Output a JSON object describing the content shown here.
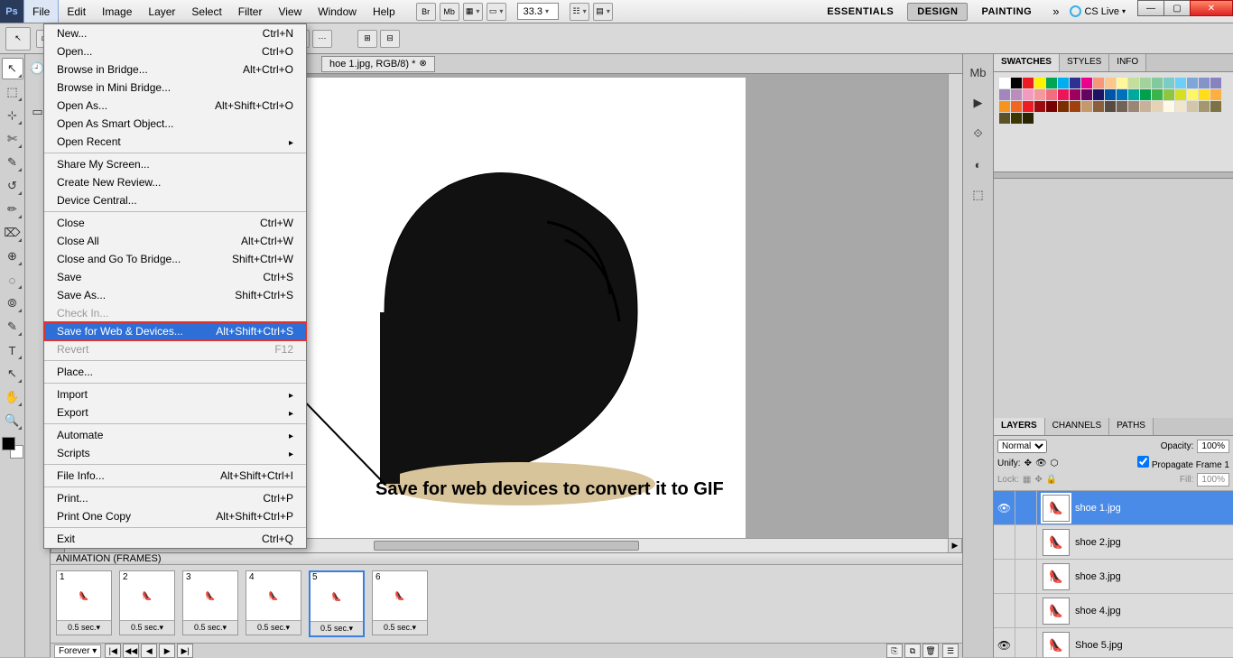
{
  "menubar": {
    "items": [
      "File",
      "Edit",
      "Image",
      "Layer",
      "Select",
      "Filter",
      "View",
      "Window",
      "Help"
    ],
    "active": 0,
    "br_btn": "Br",
    "mb_btn": "Mb",
    "zoom": "33.3",
    "workspaces": [
      "ESSENTIALS",
      "DESIGN",
      "PAINTING"
    ],
    "ws_selected": 1,
    "more": "»",
    "cs_live": "CS Live"
  },
  "file_menu": [
    {
      "label": "New...",
      "sc": "Ctrl+N"
    },
    {
      "label": "Open...",
      "sc": "Ctrl+O"
    },
    {
      "label": "Browse in Bridge...",
      "sc": "Alt+Ctrl+O"
    },
    {
      "label": "Browse in Mini Bridge..."
    },
    {
      "label": "Open As...",
      "sc": "Alt+Shift+Ctrl+O"
    },
    {
      "label": "Open As Smart Object..."
    },
    {
      "label": "Open Recent",
      "sub": true
    },
    {
      "sep": true
    },
    {
      "label": "Share My Screen..."
    },
    {
      "label": "Create New Review..."
    },
    {
      "label": "Device Central..."
    },
    {
      "sep": true
    },
    {
      "label": "Close",
      "sc": "Ctrl+W"
    },
    {
      "label": "Close All",
      "sc": "Alt+Ctrl+W"
    },
    {
      "label": "Close and Go To Bridge...",
      "sc": "Shift+Ctrl+W"
    },
    {
      "label": "Save",
      "sc": "Ctrl+S"
    },
    {
      "label": "Save As...",
      "sc": "Shift+Ctrl+S"
    },
    {
      "label": "Check In...",
      "disabled": true
    },
    {
      "label": "Save for Web & Devices...",
      "sc": "Alt+Shift+Ctrl+S",
      "hl": true
    },
    {
      "label": "Revert",
      "sc": "F12",
      "disabled": true
    },
    {
      "sep": true
    },
    {
      "label": "Place..."
    },
    {
      "sep": true
    },
    {
      "label": "Import",
      "sub": true
    },
    {
      "label": "Export",
      "sub": true
    },
    {
      "sep": true
    },
    {
      "label": "Automate",
      "sub": true
    },
    {
      "label": "Scripts",
      "sub": true
    },
    {
      "sep": true
    },
    {
      "label": "File Info...",
      "sc": "Alt+Shift+Ctrl+I"
    },
    {
      "sep": true
    },
    {
      "label": "Print...",
      "sc": "Ctrl+P"
    },
    {
      "label": "Print One Copy",
      "sc": "Alt+Shift+Ctrl+P"
    },
    {
      "sep": true
    },
    {
      "label": "Exit",
      "sc": "Ctrl+Q"
    }
  ],
  "doc_tab": "hoe 1.jpg, RGB/8) *",
  "annotation": "Save for web devices to convert it to GIF",
  "right_panels": {
    "top_tabs": [
      "SWATCHES",
      "STYLES",
      "INFO"
    ],
    "top_active": 0,
    "swatches": [
      "#ffffff",
      "#000000",
      "#ed1c24",
      "#fff200",
      "#00a651",
      "#00aeef",
      "#2e3192",
      "#ec008c",
      "#f7977a",
      "#fdc68a",
      "#fff799",
      "#c4df9b",
      "#a3d39c",
      "#82ca9c",
      "#7accc8",
      "#6dcff6",
      "#7da7d9",
      "#8493ca",
      "#8882be",
      "#a187be",
      "#bc8cbf",
      "#f49ac1",
      "#f5989d",
      "#f26d7d",
      "#ed145b",
      "#9e005d",
      "#630460",
      "#1b1464",
      "#0054a6",
      "#0072bc",
      "#00a99d",
      "#00a14b",
      "#39b54a",
      "#8dc63f",
      "#d7df23",
      "#fff568",
      "#ffde17",
      "#fbb040",
      "#f7941d",
      "#f26522",
      "#ed1c24",
      "#9e0b0f",
      "#790000",
      "#7b2e00",
      "#a0410d",
      "#c49a6c",
      "#8b5e3c",
      "#594a42",
      "#736357",
      "#998675",
      "#c7b299",
      "#e6d2b5",
      "#fff9e6",
      "#f1e6cc",
      "#d1c7a8",
      "#a39770",
      "#7d7246",
      "#5c5225",
      "#3c3600",
      "#2b2400"
    ],
    "icons": [
      "Mb",
      "▶",
      "⟐",
      "◐",
      "⬚"
    ],
    "layers_tabs": [
      "LAYERS",
      "CHANNELS",
      "PATHS"
    ],
    "layers_active": 0,
    "blend": "Normal",
    "opacity_label": "Opacity:",
    "opacity": "100%",
    "unify": "Unify:",
    "propagate": "Propagate Frame 1",
    "lock": "Lock:",
    "fill_label": "Fill:",
    "fill": "100%",
    "layers": [
      {
        "name": "shoe 1.jpg",
        "sel": true,
        "eye": true
      },
      {
        "name": "shoe 2.jpg"
      },
      {
        "name": "shoe 3.jpg"
      },
      {
        "name": "shoe 4.jpg"
      },
      {
        "name": "Shoe 5.jpg",
        "eye": true
      }
    ]
  },
  "animation": {
    "title": "ANIMATION (FRAMES)",
    "frames": [
      {
        "idx": 1,
        "delay": "0.5 sec.▾"
      },
      {
        "idx": 2,
        "delay": "0.5 sec.▾"
      },
      {
        "idx": 3,
        "delay": "0.5 sec.▾"
      },
      {
        "idx": 4,
        "delay": "0.5 sec.▾"
      },
      {
        "idx": 5,
        "delay": "0.5 sec.▾",
        "sel": true
      },
      {
        "idx": 6,
        "delay": "0.5 sec.▾"
      }
    ],
    "loop": "Forever ▾",
    "controls": [
      "|◀",
      "◀◀",
      "◀",
      "▶",
      "▶|"
    ],
    "extra": [
      "⎘",
      "⧉",
      "🗑"
    ]
  },
  "tools_left": [
    "↖",
    "⬚",
    "⊹",
    "✄",
    "✎",
    "↺",
    "✏",
    "⌦",
    "⊕",
    "◌",
    "⦾",
    "✎",
    "T",
    "↖",
    "✋",
    "🔍"
  ]
}
